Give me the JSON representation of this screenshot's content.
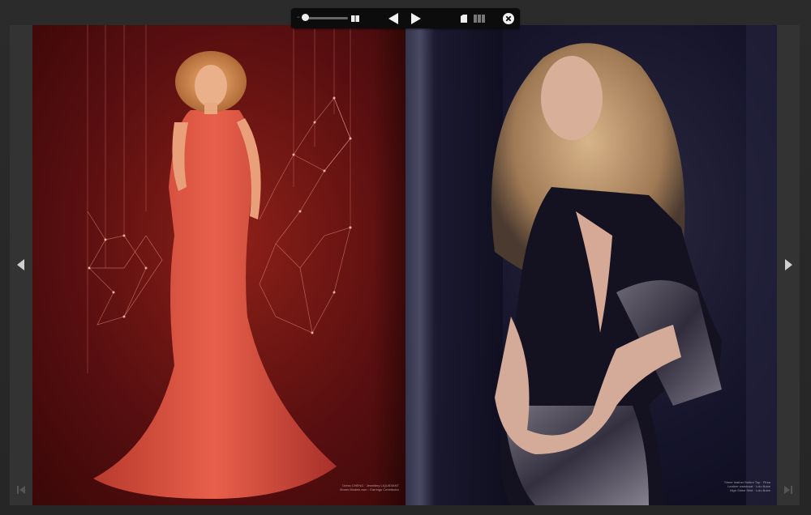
{
  "viewer": {
    "toolbar": {
      "zoom_icon": "zoom-out-icon",
      "zoom_slider_icon": "zoom-slider",
      "spread_icon": "two-page-spread-icon",
      "prev_icon": "triangle-left-icon",
      "next_icon": "triangle-right-icon",
      "single_page_icon": "single-page-icon",
      "thumbnails_icon": "thumbnails-icon",
      "close_icon": "close-circle-icon"
    },
    "nav": {
      "left_arrow": "chevron-left-icon",
      "right_arrow": "chevron-right-icon",
      "first_page": "first-page-icon",
      "last_page": "last-page-icon"
    },
    "colors": {
      "left_page": "#6b1412",
      "right_page": "#14132a",
      "toolbar": "#0c0c0c"
    }
  },
  "spread": {
    "left_page": {
      "credit_line1": "Dress CHENG · Jewellery LIQUIDIANT",
      "credit_line2": "Shoes Models own · Earrings Contributor"
    },
    "right_page": {
      "credit_line1": "Sheer leather Bolero Top · Pirsa",
      "credit_line2": "Leather waistcoat · Lolo Bobe",
      "credit_line3": "High Shine Skirt · Lolo Bobe"
    }
  }
}
